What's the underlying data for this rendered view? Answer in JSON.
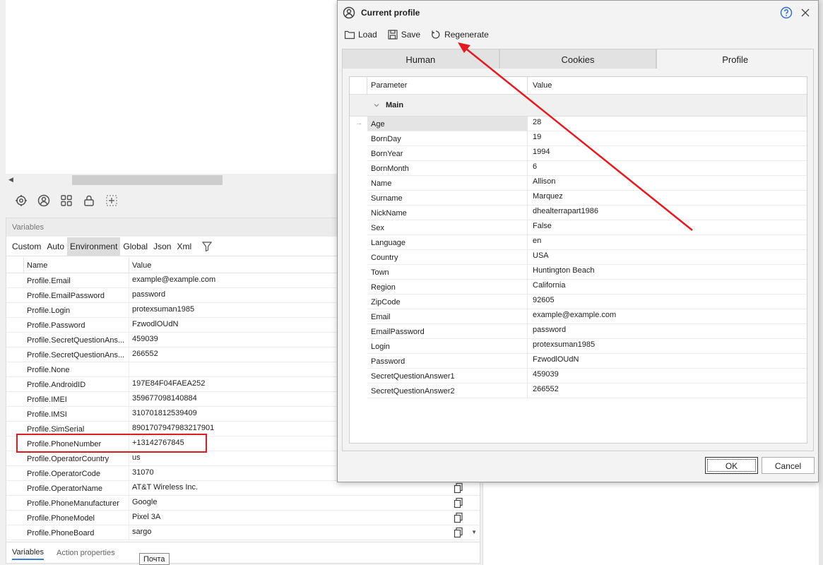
{
  "background": {
    "variables_header": "Variables",
    "var_tabs": [
      "Custom",
      "Auto",
      "Environment",
      "Global",
      "Json",
      "Xml"
    ],
    "active_var_tab": "Environment",
    "columns": {
      "name": "Name",
      "value": "Value"
    },
    "rows": [
      {
        "name": "Profile.Email",
        "value": "example@example.com"
      },
      {
        "name": "Profile.EmailPassword",
        "value": "password"
      },
      {
        "name": "Profile.Login",
        "value": "protexsuman1985"
      },
      {
        "name": "Profile.Password",
        "value": "FzwodlOUdN"
      },
      {
        "name": "Profile.SecretQuestionAns...",
        "value": "459039"
      },
      {
        "name": "Profile.SecretQuestionAns...",
        "value": "266552"
      },
      {
        "name": "Profile.None",
        "value": ""
      },
      {
        "name": "Profile.AndroidID",
        "value": "197E84F04FAEA252"
      },
      {
        "name": "Profile.IMEI",
        "value": "359677098140884"
      },
      {
        "name": "Profile.IMSI",
        "value": "310701812539409"
      },
      {
        "name": "Profile.SimSerial",
        "value": "8901707947983217901"
      },
      {
        "name": "Profile.PhoneNumber",
        "value": "+13142767845"
      },
      {
        "name": "Profile.OperatorCountry",
        "value": "us"
      },
      {
        "name": "Profile.OperatorCode",
        "value": "31070"
      },
      {
        "name": "Profile.OperatorName",
        "value": "AT&T Wireless Inc."
      },
      {
        "name": "Profile.PhoneManufacturer",
        "value": "Google"
      },
      {
        "name": "Profile.PhoneModel",
        "value": "Pixel 3A"
      },
      {
        "name": "Profile.PhoneBoard",
        "value": "sargo"
      }
    ],
    "bottom_tabs": [
      "Variables",
      "Action properties"
    ],
    "tooltip": "Почта",
    "toolbar_icons": [
      "settings-icon",
      "profile-icon",
      "grid-icon",
      "lock-icon",
      "add-frame-icon"
    ],
    "highlight_color": "#e11b22"
  },
  "dialog": {
    "title": "Current profile",
    "toolbar": {
      "load": "Load",
      "save": "Save",
      "regenerate": "Regenerate"
    },
    "tabs": [
      "Human",
      "Cookies",
      "Profile"
    ],
    "active_tab": "Profile",
    "columns": {
      "parameter": "Parameter",
      "value": "Value"
    },
    "group": "Main",
    "selected_row": "Age",
    "params": [
      {
        "name": "Age",
        "value": "28"
      },
      {
        "name": "BornDay",
        "value": "19"
      },
      {
        "name": "BornYear",
        "value": "1994"
      },
      {
        "name": "BornMonth",
        "value": "6"
      },
      {
        "name": "Name",
        "value": "Allison"
      },
      {
        "name": "Surname",
        "value": "Marquez"
      },
      {
        "name": "NickName",
        "value": "dhealterrapart1986"
      },
      {
        "name": "Sex",
        "value": "False"
      },
      {
        "name": "Language",
        "value": "en"
      },
      {
        "name": "Country",
        "value": "USA"
      },
      {
        "name": "Town",
        "value": "Huntington Beach"
      },
      {
        "name": "Region",
        "value": "California"
      },
      {
        "name": "ZipCode",
        "value": "92605"
      },
      {
        "name": "Email",
        "value": "example@example.com"
      },
      {
        "name": "EmailPassword",
        "value": "password"
      },
      {
        "name": "Login",
        "value": "protexsuman1985"
      },
      {
        "name": "Password",
        "value": "FzwodlOUdN"
      },
      {
        "name": "SecretQuestionAnswer1",
        "value": "459039"
      },
      {
        "name": "SecretQuestionAnswer2",
        "value": "266552"
      }
    ],
    "buttons": {
      "ok": "OK",
      "cancel": "Cancel"
    }
  }
}
